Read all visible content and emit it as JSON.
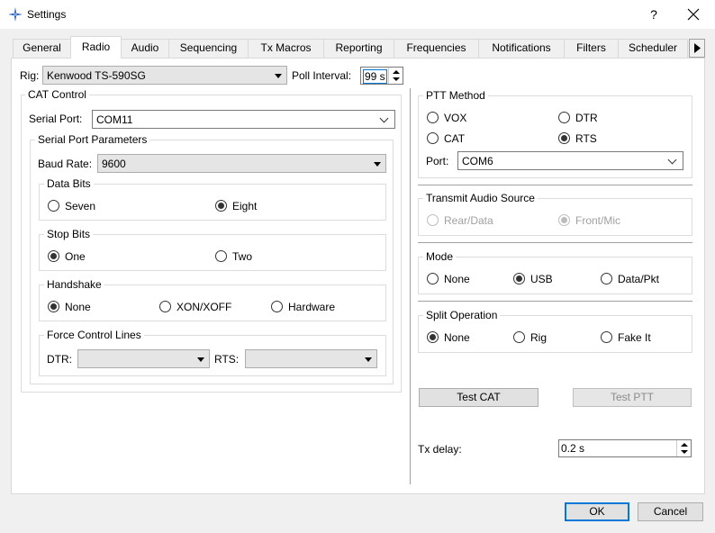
{
  "window": {
    "title": "Settings",
    "help": "?"
  },
  "tabs": [
    {
      "label": "General"
    },
    {
      "label": "Radio"
    },
    {
      "label": "Audio"
    },
    {
      "label": "Sequencing"
    },
    {
      "label": "Tx Macros"
    },
    {
      "label": "Reporting"
    },
    {
      "label": "Frequencies"
    },
    {
      "label": "Notifications"
    },
    {
      "label": "Filters"
    },
    {
      "label": "Scheduler"
    }
  ],
  "rig": {
    "label": "Rig:",
    "value": "Kenwood TS-590SG"
  },
  "poll": {
    "label": "Poll Interval:",
    "value": "99 s"
  },
  "cat": {
    "title": "CAT Control",
    "serial_port_label": "Serial Port:",
    "serial_port_value": "COM11",
    "params_title": "Serial Port Parameters",
    "baud_label": "Baud Rate:",
    "baud_value": "9600",
    "data_bits": {
      "title": "Data Bits",
      "seven": "Seven",
      "eight": "Eight"
    },
    "stop_bits": {
      "title": "Stop Bits",
      "one": "One",
      "two": "Two"
    },
    "handshake": {
      "title": "Handshake",
      "none": "None",
      "xon": "XON/XOFF",
      "hardware": "Hardware"
    },
    "force": {
      "title": "Force Control Lines",
      "dtr_label": "DTR:",
      "dtr_value": "",
      "rts_label": "RTS:",
      "rts_value": ""
    }
  },
  "ptt": {
    "title": "PTT Method",
    "vox": "VOX",
    "dtr": "DTR",
    "cat": "CAT",
    "rts": "RTS",
    "port_label": "Port:",
    "port_value": "COM6"
  },
  "audio_source": {
    "title": "Transmit Audio Source",
    "rear": "Rear/Data",
    "front": "Front/Mic"
  },
  "mode": {
    "title": "Mode",
    "none": "None",
    "usb": "USB",
    "data": "Data/Pkt"
  },
  "split": {
    "title": "Split Operation",
    "none": "None",
    "rig": "Rig",
    "fake": "Fake It"
  },
  "buttons": {
    "test_cat": "Test CAT",
    "test_ptt": "Test PTT",
    "ok": "OK",
    "cancel": "Cancel"
  },
  "tx_delay": {
    "label": "Tx delay:",
    "value": "0.2 s"
  }
}
